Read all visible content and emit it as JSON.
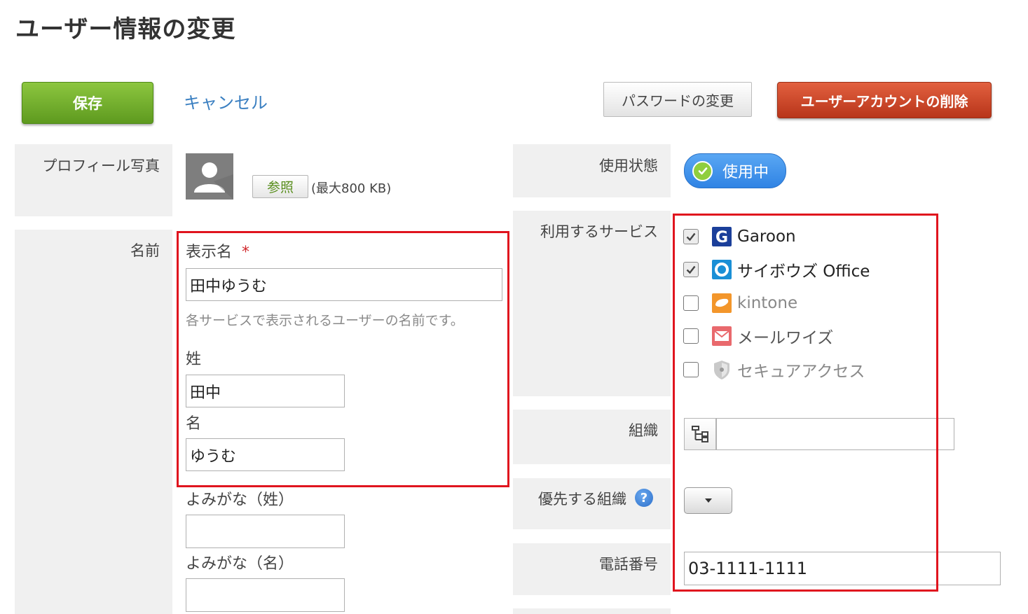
{
  "page": {
    "title": "ユーザー情報の変更"
  },
  "toolbar": {
    "save_label": "保存",
    "cancel_label": "キャンセル",
    "change_password_label": "パスワードの変更",
    "delete_account_label": "ユーザーアカウントの削除"
  },
  "profile": {
    "label": "プロフィール写真",
    "browse_label": "参照",
    "max_size": "(最大800 KB)"
  },
  "status": {
    "label": "使用状態",
    "value": "使用中"
  },
  "name": {
    "label": "名前",
    "display_name_label": "表示名",
    "required_mark": "*",
    "display_name_value": "田中ゆうむ",
    "display_name_hint": "各サービスで表示されるユーザーの名前です。",
    "last_name_label": "姓",
    "last_name_value": "田中",
    "first_name_label": "名",
    "first_name_value": "ゆうむ",
    "reading_last_label": "よみがな（姓）",
    "reading_last_value": "",
    "reading_first_label": "よみがな（名）",
    "reading_first_value": ""
  },
  "services": {
    "label": "利用するサービス",
    "items": [
      {
        "name": "Garoon",
        "checked": true,
        "icon": "garoon-icon",
        "color": "#222222"
      },
      {
        "name": "サイボウズ Office",
        "checked": true,
        "icon": "cybozu-office-icon",
        "color": "#222222"
      },
      {
        "name": "kintone",
        "checked": false,
        "icon": "kintone-icon",
        "color": "#888888"
      },
      {
        "name": "メールワイズ",
        "checked": false,
        "icon": "mailwise-icon",
        "color": "#555555"
      },
      {
        "name": "セキュアアクセス",
        "checked": false,
        "icon": "secure-access-icon",
        "color": "#888888"
      }
    ]
  },
  "organization": {
    "label": "組織",
    "value": ""
  },
  "primary_org": {
    "label": "優先する組織",
    "help": "?"
  },
  "phone": {
    "label": "電話番号",
    "value": "03-1111-1111"
  },
  "colors": {
    "save": "#6aab2b",
    "delete": "#c9442a",
    "status": "#3b8ee8",
    "link": "#3a7fc1",
    "highlight": "#e0141e"
  }
}
